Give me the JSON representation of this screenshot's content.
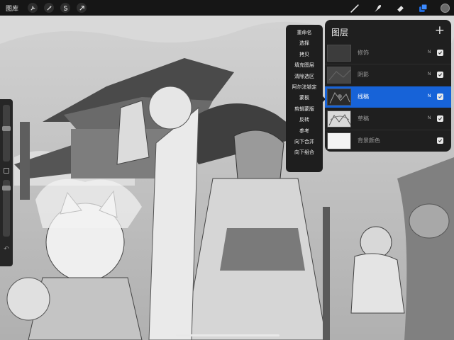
{
  "toolbar": {
    "gallery_label": "图库",
    "left_tools": [
      {
        "name": "wrench-icon"
      },
      {
        "name": "magic-wand-icon"
      },
      {
        "name": "selection-s-icon"
      },
      {
        "name": "transform-arrow-icon"
      }
    ],
    "right_tools": [
      {
        "name": "brush-icon"
      },
      {
        "name": "smudge-icon"
      },
      {
        "name": "eraser-icon"
      },
      {
        "name": "layers-icon"
      }
    ],
    "active_tool_color": "#1e6ee8",
    "current_color": "#6a6a6a"
  },
  "layer_menu": {
    "items": [
      "重命名",
      "选择",
      "拷贝",
      "填充图层",
      "清除选区",
      "阿尔法锁定",
      "蒙板",
      "剪辑蒙版",
      "反转",
      "参考",
      "向下合并",
      "向下组合"
    ]
  },
  "layers_panel": {
    "title": "图层",
    "add_icon": "+",
    "layers": [
      {
        "name": "修饰",
        "blend": "N",
        "visible": true,
        "selected": false
      },
      {
        "name": "阴影",
        "blend": "N",
        "visible": true,
        "selected": false
      },
      {
        "name": "线稿",
        "blend": "N",
        "visible": true,
        "selected": true
      },
      {
        "name": "草稿",
        "blend": "N",
        "visible": true,
        "selected": false
      },
      {
        "name": "背景颜色",
        "blend": "",
        "visible": true,
        "selected": false
      }
    ],
    "selected_color": "#1763d8"
  },
  "sidebar": {
    "brush_size_level": 0.18,
    "opacity_level": 0.12,
    "undo_icon": "↶"
  }
}
